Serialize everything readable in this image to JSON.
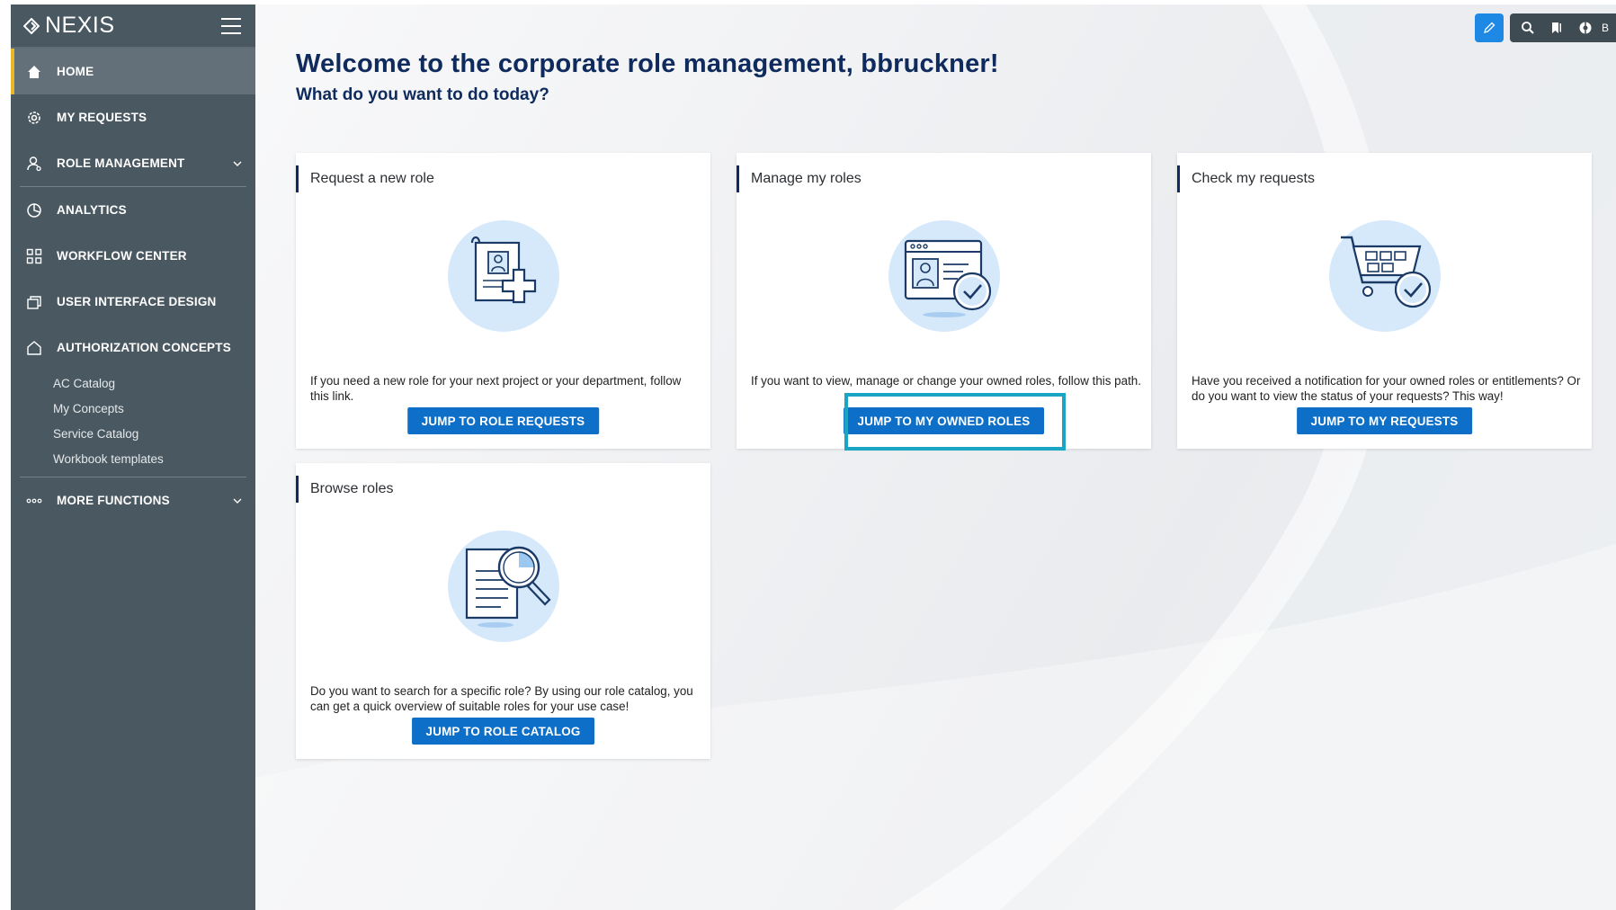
{
  "app": {
    "logo_text": "NEXIS"
  },
  "sidebar": {
    "items": [
      {
        "label": "HOME"
      },
      {
        "label": "MY REQUESTS"
      },
      {
        "label": "ROLE MANAGEMENT"
      },
      {
        "label": "ANALYTICS"
      },
      {
        "label": "WORKFLOW CENTER"
      },
      {
        "label": "USER INTERFACE DESIGN"
      },
      {
        "label": "AUTHORIZATION CONCEPTS"
      }
    ],
    "sub_items": [
      {
        "label": "AC Catalog"
      },
      {
        "label": "My Concepts"
      },
      {
        "label": "Service Catalog"
      },
      {
        "label": "Workbook templates"
      }
    ],
    "more": {
      "label": "MORE FUNCTIONS"
    }
  },
  "toolbar": {
    "user_initial": "B"
  },
  "main": {
    "welcome": "Welcome to the corporate role management, bbruckner!",
    "subtitle": "What do you want to do today?",
    "cards": [
      {
        "title": "Request a new role",
        "text": "If you need a new role for your next project or your department, follow this link.",
        "button": "JUMP TO ROLE REQUESTS"
      },
      {
        "title": "Manage my roles",
        "text": "If you want to view, manage or change your owned roles, follow this path.",
        "button": "JUMP TO MY OWNED ROLES"
      },
      {
        "title": "Check my requests",
        "text": "Have you received a notification for your owned roles or entitlements? Or do you want to view the status of your requests? This way!",
        "button": "JUMP TO MY REQUESTS"
      },
      {
        "title": "Browse roles",
        "text": "Do you want to search for a specific role? By using our role catalog, you can get a quick overview of suitable roles for your use case!",
        "button": "JUMP TO ROLE CATALOG"
      }
    ]
  },
  "colors": {
    "sidebar_bg": "#4a5861",
    "active_accent": "#e8b723",
    "primary_button": "#0d6fc8",
    "heading": "#0f2a5c",
    "highlight": "#1aa5c4"
  }
}
